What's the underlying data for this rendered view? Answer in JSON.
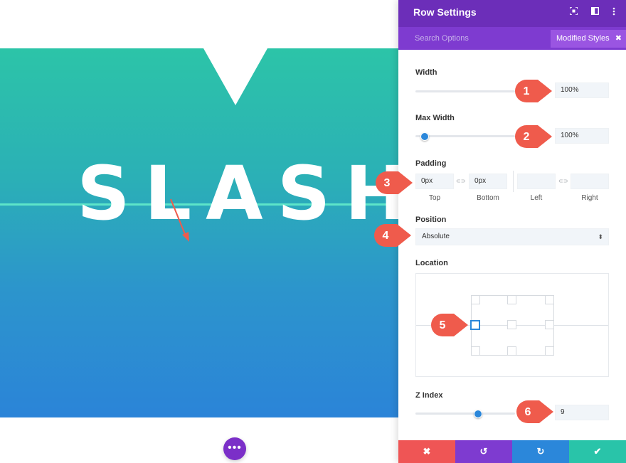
{
  "hero": {
    "title": "SLASH"
  },
  "more_button": {
    "icon": "more-dots-icon",
    "glyph": "•••"
  },
  "panel": {
    "title": "Row Settings",
    "header_icons": [
      "focus-icon",
      "split-view-icon",
      "kebab-menu-icon"
    ],
    "tabs": {
      "search": "Search Options",
      "modified": "Modified Styles"
    },
    "width": {
      "label": "Width",
      "value": "100%",
      "slider_fraction": 1.0
    },
    "max_width": {
      "label": "Max Width",
      "value": "100%",
      "slider_fraction": 0.0
    },
    "padding": {
      "label": "Padding",
      "top": {
        "value": "0px",
        "label": "Top"
      },
      "bottom": {
        "value": "0px",
        "label": "Bottom"
      },
      "left": {
        "value": "",
        "label": "Left"
      },
      "right": {
        "value": "",
        "label": "Right"
      }
    },
    "position": {
      "label": "Position",
      "value": "Absolute"
    },
    "location": {
      "label": "Location",
      "selected": "left-center"
    },
    "z_index": {
      "label": "Z Index",
      "value": "9",
      "slider_fraction": 0.6
    },
    "footer": {
      "cancel": {
        "icon": "close-icon",
        "glyph": "✖",
        "color": "#ef5555"
      },
      "undo": {
        "icon": "undo-icon",
        "glyph": "↺",
        "color": "#7e3bd0"
      },
      "redo": {
        "icon": "redo-icon",
        "glyph": "↻",
        "color": "#2b87da"
      },
      "save": {
        "icon": "check-icon",
        "glyph": "✔",
        "color": "#29c4a9"
      }
    }
  },
  "callouts": [
    "1",
    "2",
    "3",
    "4",
    "5",
    "6"
  ],
  "colors": {
    "callout": "#ef5b4c",
    "accent_purple": "#6c2eb9",
    "accent_blue": "#2b87da"
  }
}
